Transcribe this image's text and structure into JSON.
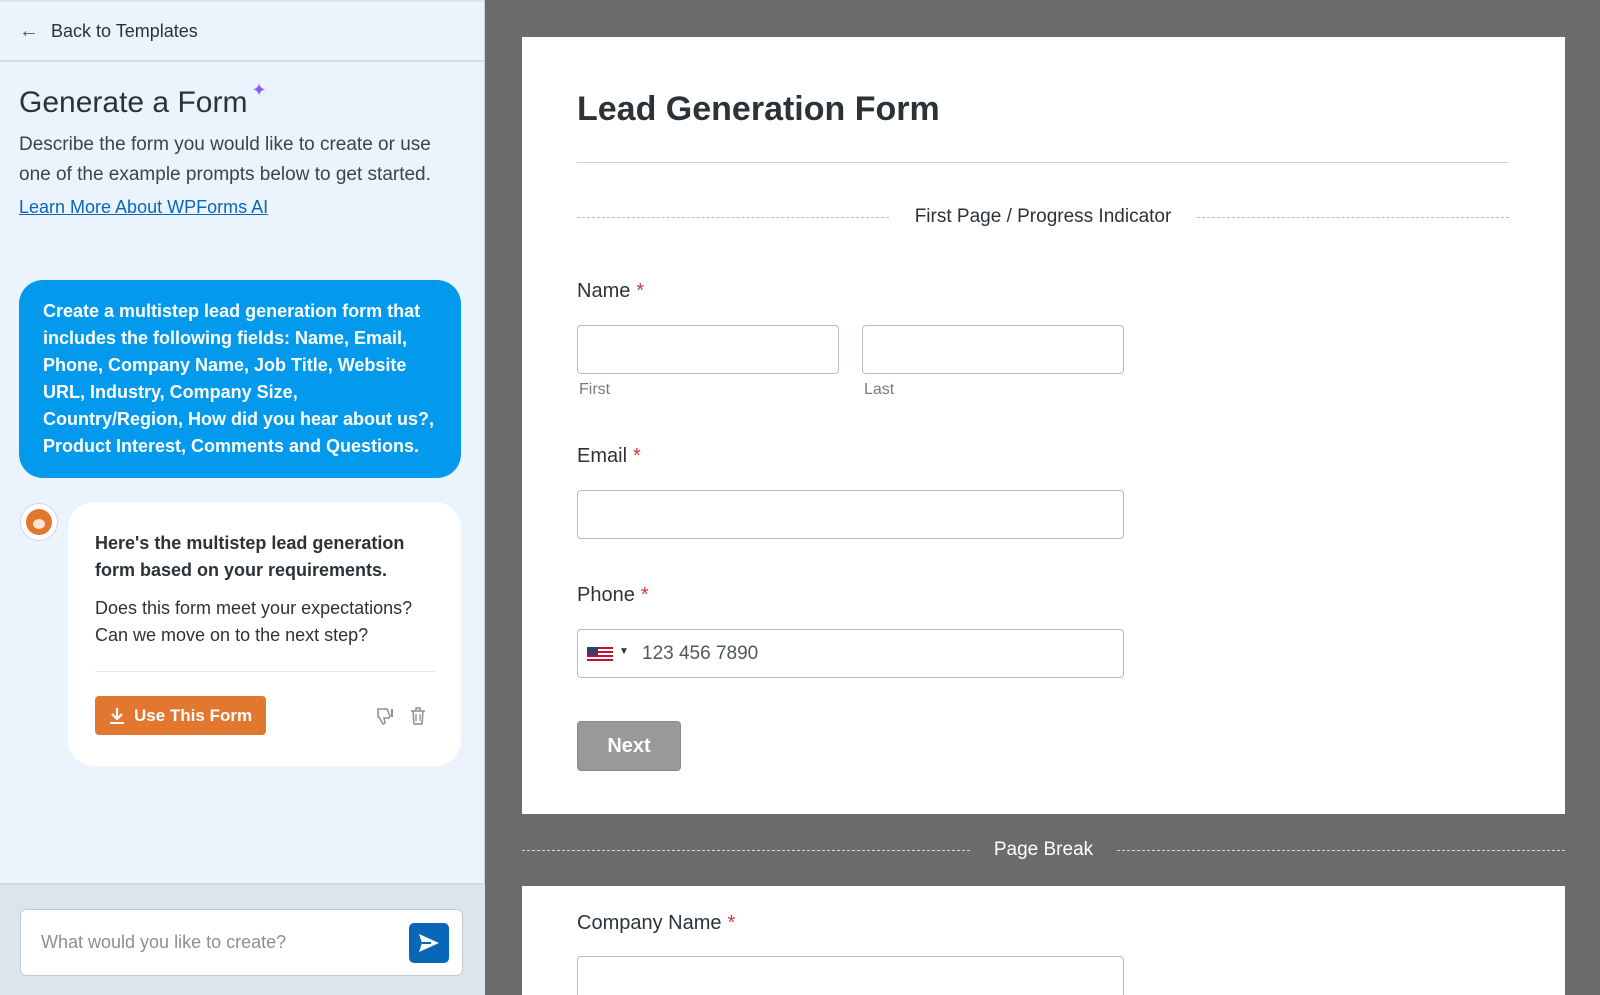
{
  "sidebar": {
    "back_label": "Back to Templates",
    "title": "Generate a Form",
    "description": "Describe the form you would like to create or use one of the example prompts below to get started.",
    "learn_more": "Learn More About WPForms AI",
    "user_message": "Create a multistep lead generation form that includes the following fields: Name, Email, Phone, Company Name, Job Title, Website URL, Industry, Company Size, Country/Region, How did you hear about us?, Product Interest, Comments and Questions.",
    "bot_message_strong": "Here's the multistep lead generation form based on your requirements.",
    "bot_message_question": "Does this form meet your expectations? Can we move on to the next step?",
    "use_form_label": "Use This Form",
    "prompt_placeholder": "What would you like to create?"
  },
  "form": {
    "title": "Lead Generation Form",
    "first_page_label": "First Page / Progress Indicator",
    "fields": {
      "name_label": "Name",
      "name_first": "First",
      "name_last": "Last",
      "email_label": "Email",
      "phone_label": "Phone",
      "phone_placeholder": "123 456 7890",
      "company_label": "Company Name",
      "required_mark": "*"
    },
    "next_label": "Next",
    "page_break_label": "Page Break"
  },
  "colors": {
    "accent_blue": "#0399ed",
    "orange": "#e27730",
    "required_red": "#d63638",
    "preview_bg": "#6b6b6b"
  },
  "icons": {
    "back": "arrow-left-icon",
    "sparkle": "sparkle-icon",
    "download": "download-icon",
    "thumbs_down": "thumbs-down-icon",
    "trash": "trash-icon",
    "send": "send-icon",
    "flag": "us-flag-icon"
  }
}
